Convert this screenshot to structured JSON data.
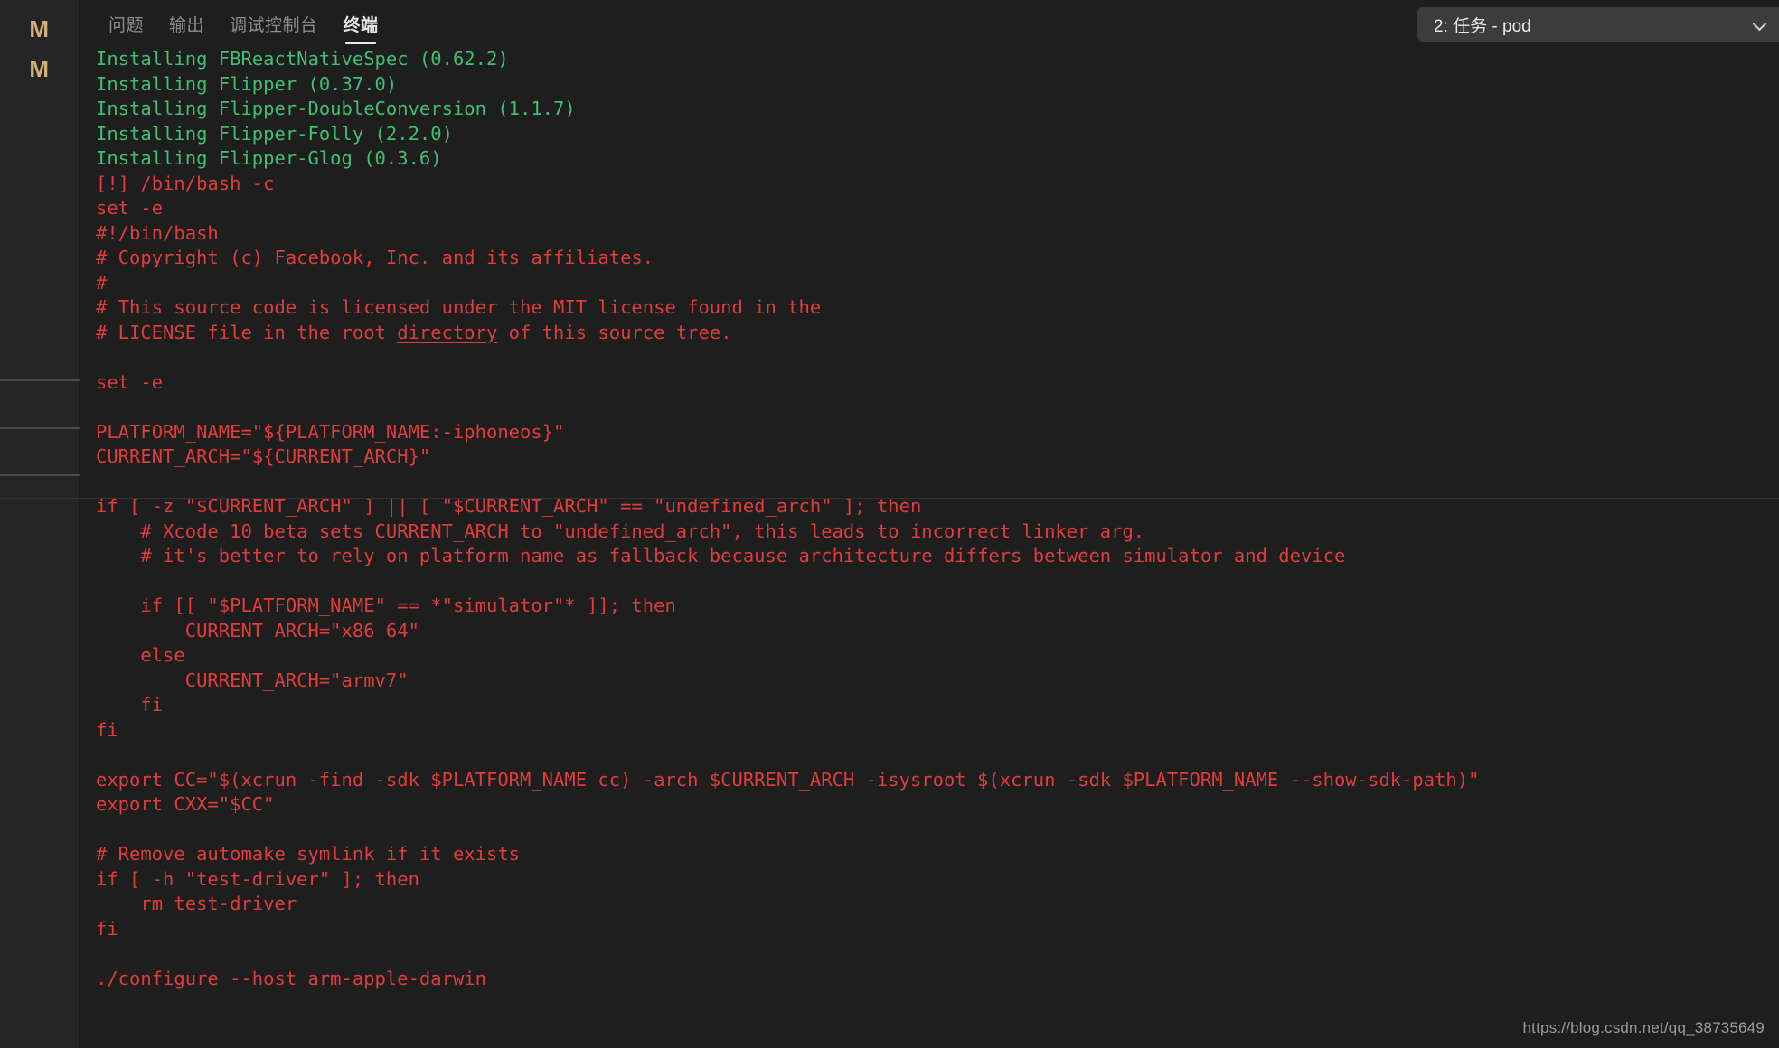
{
  "gutter": {
    "marks": [
      "M",
      "M"
    ],
    "mark_color": "#d1b07a"
  },
  "panel": {
    "tabs": [
      {
        "label": "问题",
        "active": false
      },
      {
        "label": "输出",
        "active": false
      },
      {
        "label": "调试控制台",
        "active": false
      },
      {
        "label": "终端",
        "active": true
      }
    ],
    "terminal_selector": {
      "value": "2: 任务 - pod",
      "icon": "chevron-down-icon"
    }
  },
  "colors": {
    "background": "#1e1e1e",
    "sidebar": "#252526",
    "green": "#3fbf72",
    "red": "#e03c3c",
    "selector_bg": "#3c3c3c"
  },
  "terminal": {
    "lines": [
      {
        "color": "green",
        "text": "Installing FBReactNativeSpec (0.62.2)"
      },
      {
        "color": "green",
        "text": "Installing Flipper (0.37.0)"
      },
      {
        "color": "green",
        "text": "Installing Flipper-DoubleConversion (1.1.7)"
      },
      {
        "color": "green",
        "text": "Installing Flipper-Folly (2.2.0)"
      },
      {
        "color": "green",
        "text": "Installing Flipper-Glog (0.3.6)"
      },
      {
        "color": "red",
        "text": "[!] /bin/bash -c"
      },
      {
        "color": "red",
        "text": "set -e"
      },
      {
        "color": "red",
        "text": "#!/bin/bash"
      },
      {
        "color": "red",
        "text": "# Copyright (c) Facebook, Inc. and its affiliates."
      },
      {
        "color": "red",
        "text": "#"
      },
      {
        "color": "red",
        "text": "# This source code is licensed under the MIT license found in the"
      },
      {
        "color": "red",
        "text": "# LICENSE file in the root ",
        "link": "directory",
        "text_after": " of this source tree."
      },
      {
        "color": "red",
        "text": ""
      },
      {
        "color": "red",
        "text": "set -e"
      },
      {
        "color": "red",
        "text": ""
      },
      {
        "color": "red",
        "text": "PLATFORM_NAME=\"${PLATFORM_NAME:-iphoneos}\""
      },
      {
        "color": "red",
        "text": "CURRENT_ARCH=\"${CURRENT_ARCH}\""
      },
      {
        "color": "red",
        "text": ""
      },
      {
        "color": "red",
        "text": "if [ -z \"$CURRENT_ARCH\" ] || [ \"$CURRENT_ARCH\" == \"undefined_arch\" ]; then"
      },
      {
        "color": "red",
        "text": "    # Xcode 10 beta sets CURRENT_ARCH to \"undefined_arch\", this leads to incorrect linker arg."
      },
      {
        "color": "red",
        "text": "    # it's better to rely on platform name as fallback because architecture differs between simulator and device"
      },
      {
        "color": "red",
        "text": ""
      },
      {
        "color": "red",
        "text": "    if [[ \"$PLATFORM_NAME\" == *\"simulator\"* ]]; then"
      },
      {
        "color": "red",
        "text": "        CURRENT_ARCH=\"x86_64\""
      },
      {
        "color": "red",
        "text": "    else"
      },
      {
        "color": "red",
        "text": "        CURRENT_ARCH=\"armv7\""
      },
      {
        "color": "red",
        "text": "    fi"
      },
      {
        "color": "red",
        "text": "fi"
      },
      {
        "color": "red",
        "text": ""
      },
      {
        "color": "red",
        "text": "export CC=\"$(xcrun -find -sdk $PLATFORM_NAME cc) -arch $CURRENT_ARCH -isysroot $(xcrun -sdk $PLATFORM_NAME --show-sdk-path)\""
      },
      {
        "color": "red",
        "text": "export CXX=\"$CC\""
      },
      {
        "color": "red",
        "text": ""
      },
      {
        "color": "red",
        "text": "# Remove automake symlink if it exists"
      },
      {
        "color": "red",
        "text": "if [ -h \"test-driver\" ]; then"
      },
      {
        "color": "red",
        "text": "    rm test-driver"
      },
      {
        "color": "red",
        "text": "fi"
      },
      {
        "color": "red",
        "text": ""
      },
      {
        "color": "red",
        "text": "./configure --host arm-apple-darwin"
      }
    ]
  },
  "watermark": {
    "text": "https://blog.csdn.net/qq_38735649"
  }
}
